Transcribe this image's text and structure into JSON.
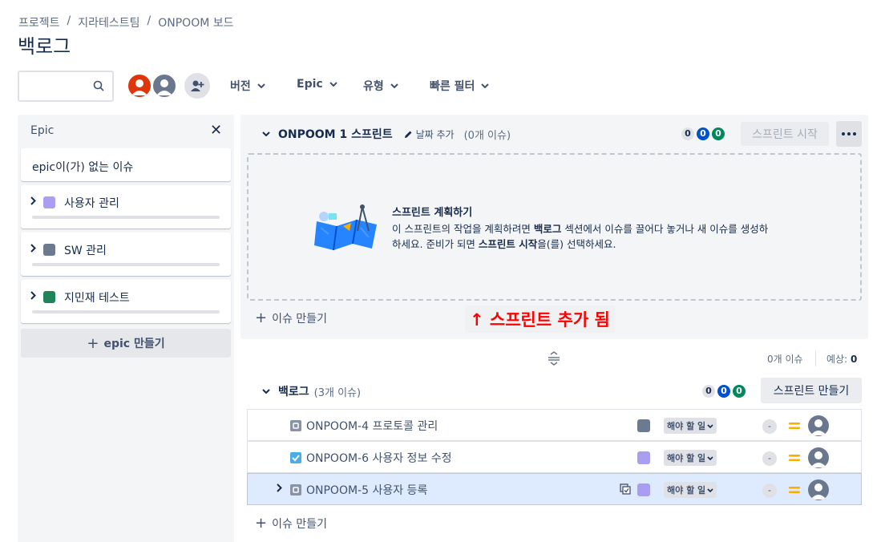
{
  "breadcrumb": [
    "프로젝트",
    "지라테스트팀",
    "ONPOOM 보드"
  ],
  "page_title": "백로그",
  "toolbar": {
    "search_placeholder": "",
    "filters": [
      "버전",
      "Epic",
      "유형",
      "빠른 필터"
    ]
  },
  "epic_panel": {
    "title": "Epic",
    "no_epic_bold": "epic",
    "no_epic_rest": "이(가) 없는 이슈",
    "epics": [
      {
        "name": "사용자 관리",
        "color": "#a99ef0"
      },
      {
        "name": "SW 관리",
        "color": "#6b7a8f"
      },
      {
        "name": "지민재 테스트",
        "color": "#1f845a"
      }
    ],
    "create_label": "epic 만들기"
  },
  "sprint": {
    "name": "ONPOOM 1 스프린트",
    "date_add": "날짜 추가",
    "issue_count": "(0개 이슈)",
    "badges": [
      "0",
      "0",
      "0"
    ],
    "start_label": "스프린트 시작",
    "plan_title": "스프린트 계획하기",
    "plan_text_1": "이 스프린트의 작업을 계획하려면 ",
    "plan_text_b1": "백로그",
    "plan_text_2": " 섹션에서 이슈를 끌어다 놓거나 새 이슈를 생성하",
    "plan_text_3": "하세요. 준비가 되면 ",
    "plan_text_b2": "스프린트 시작",
    "plan_text_4": "을(를) 선택하세요.",
    "create_issue": "이슈 만들기"
  },
  "annotation": "↑ 스프린트 추가 됨",
  "summary": {
    "issues": "0개 이슈",
    "estimate_label": "예상:",
    "estimate_value": "0"
  },
  "backlog": {
    "title": "백로그",
    "issue_count": "(3개 이슈)",
    "badges": [
      "0",
      "0",
      "0"
    ],
    "create_sprint": "스프린트 만들기",
    "create_issue": "이슈 만들기",
    "issues": [
      {
        "key": "ONPOOM-4",
        "summary": "프로토콜 관리",
        "type": "task",
        "epic_color": "#6b7a8f",
        "status": "해야 할 일",
        "estimate": "-"
      },
      {
        "key": "ONPOOM-6",
        "summary": "사용자 정보 수정",
        "type": "story",
        "epic_color": "#a99ef0",
        "status": "해야 할 일",
        "estimate": "-"
      },
      {
        "key": "ONPOOM-5",
        "summary": "사용자 등록",
        "type": "task",
        "epic_color": "#a99ef0",
        "status": "해야 할 일",
        "estimate": "-"
      }
    ]
  },
  "colors": {
    "accent": "#0052cc",
    "priority": "#ffab00",
    "annotation": "#ff0000"
  }
}
